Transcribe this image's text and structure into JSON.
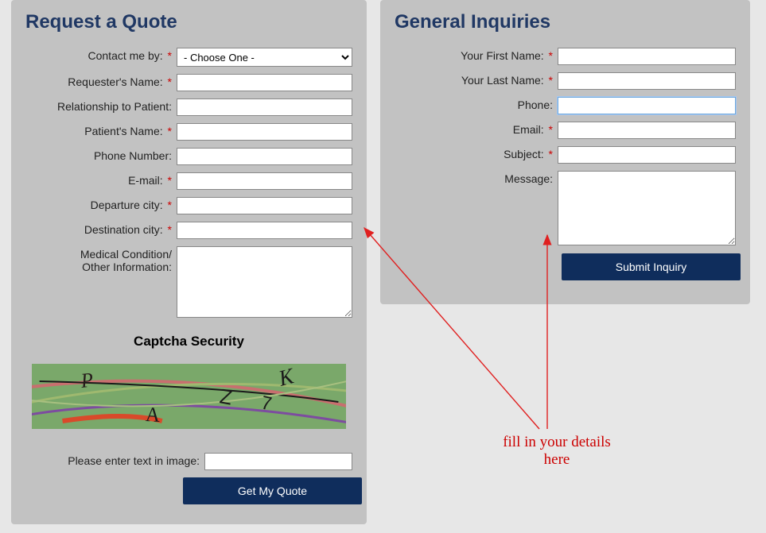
{
  "quote": {
    "title": "Request a Quote",
    "fields": {
      "contact_label": "Contact me by:",
      "contact_selected": "- Choose One -",
      "requester_label": "Requester's Name:",
      "relationship_label": "Relationship to Patient:",
      "patient_label": "Patient's Name:",
      "phone_label": "Phone Number:",
      "email_label": "E-mail:",
      "departure_label": "Departure city:",
      "destination_label": "Destination city:",
      "condition_label1": "Medical Condition/",
      "condition_label2": "Other Information:"
    },
    "captcha_title": "Captcha Security",
    "captcha_prompt": "Please enter text in image:",
    "submit_label": "Get My Quote"
  },
  "inquiry": {
    "title": "General Inquiries",
    "fields": {
      "first_label": "Your First Name:",
      "last_label": "Your Last Name:",
      "phone_label": "Phone:",
      "email_label": "Email:",
      "subject_label": "Subject:",
      "message_label": "Message:"
    },
    "submit_label": "Submit Inquiry"
  },
  "annotation": {
    "line1": "fill in your details",
    "line2": "here"
  },
  "req_marker": "*"
}
